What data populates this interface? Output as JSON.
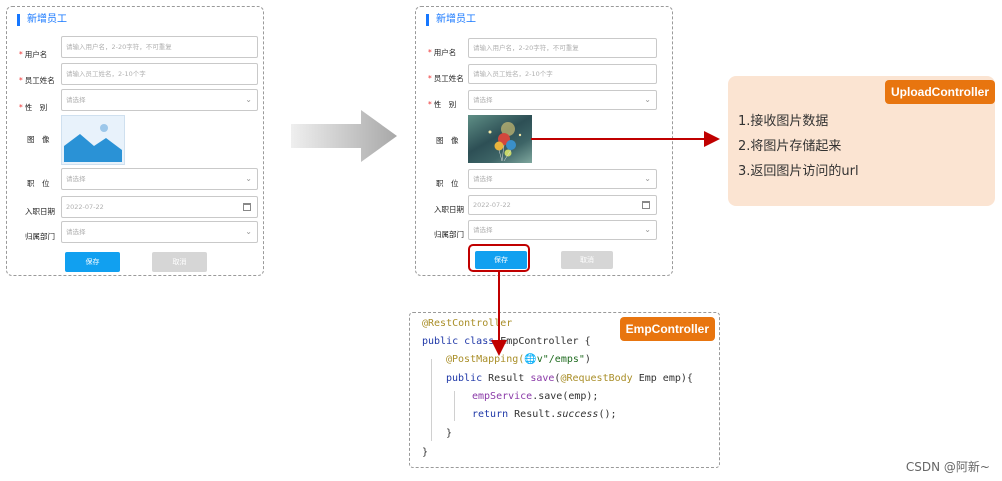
{
  "form": {
    "title": "新增员工",
    "username_label": "用户名",
    "username_placeholder": "请输入用户名，2-20字符，不可重复",
    "name_label": "员工姓名",
    "name_placeholder": "请输入员工姓名，2-10个字",
    "gender_label": "性　别",
    "gender_placeholder": "请选择",
    "image_label": "图　像",
    "job_label": "职　位",
    "job_placeholder": "请选择",
    "entry_date_label": "入职日期",
    "entry_date_value": "2022-07-22",
    "dept_label": "归属部门",
    "dept_placeholder": "请选择",
    "save_label": "保存",
    "cancel_label": "取消",
    "required_mark": "*"
  },
  "upload_controller": {
    "title": "UploadController",
    "items": [
      "1.接收图片数据",
      "2.将图片存储起来",
      "3.返回图片访问的url"
    ]
  },
  "emp_controller": {
    "title": "EmpController",
    "lines": [
      "@RestController",
      "public class EmpController {",
      "@PostMapping(\"/emps\")",
      "public Result save(@RequestBody Emp emp){",
      "empService.save(emp);",
      "return Result.success();",
      "}",
      "}"
    ]
  },
  "watermark": "CSDN @阿新~",
  "colors": {
    "accent_blue": "#11a0f0",
    "tag_orange": "#e8750f",
    "arrow_red": "#c00000",
    "panel_peach": "#fbe4d2"
  }
}
